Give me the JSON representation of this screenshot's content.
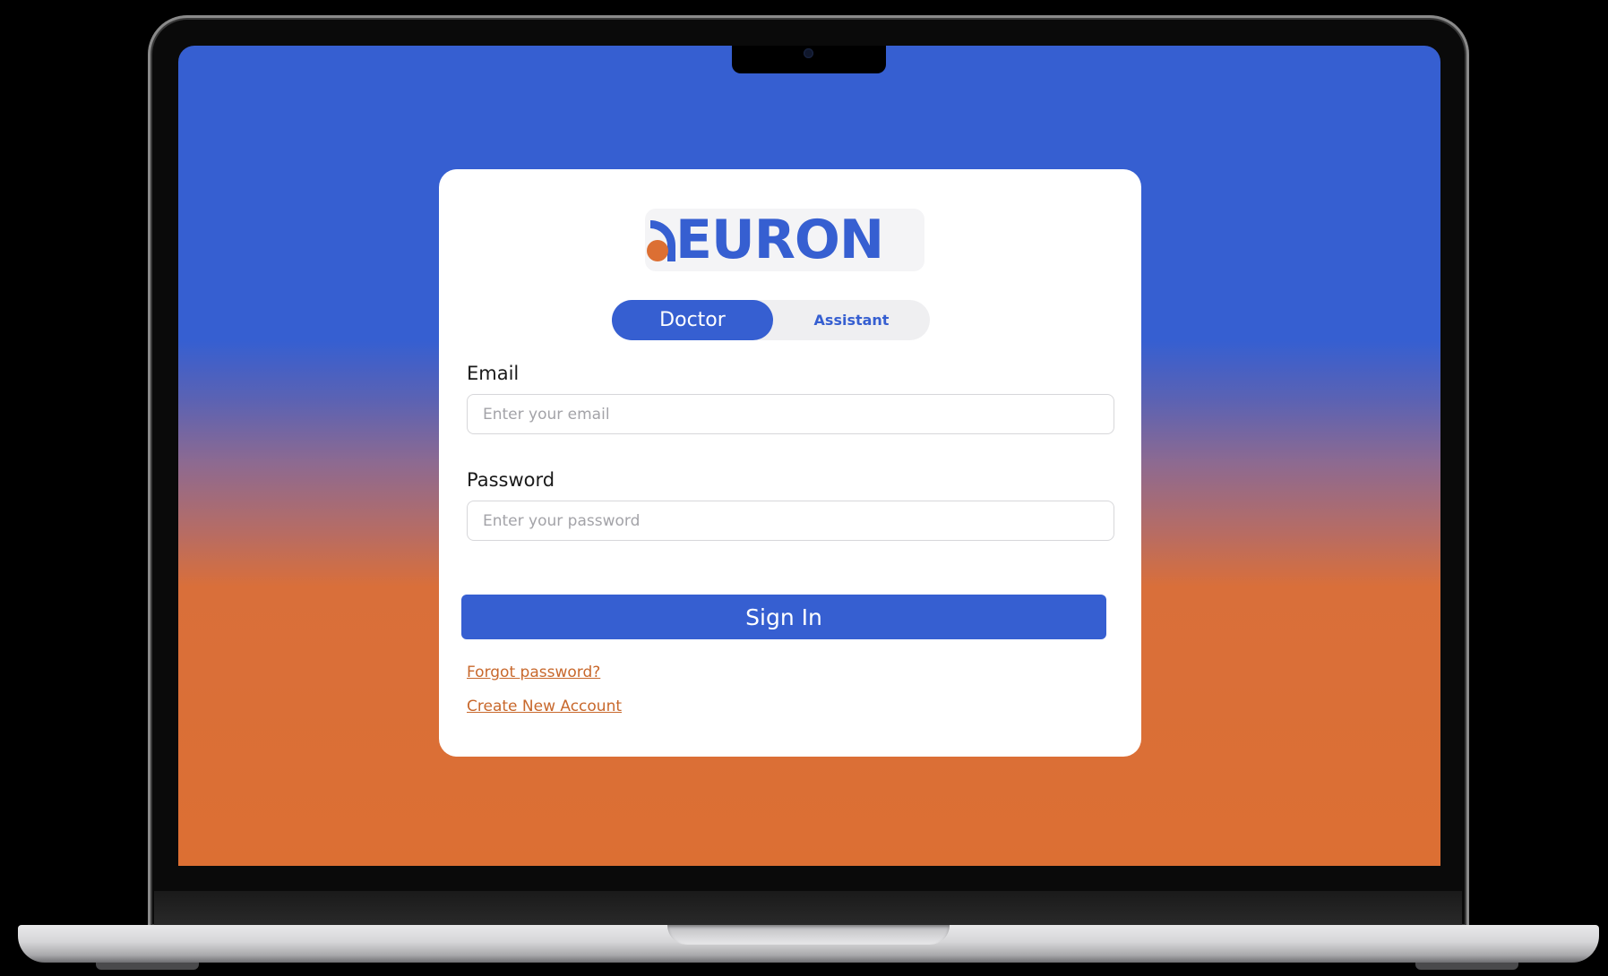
{
  "logo": {
    "wordmark": "EURON",
    "icon": "neuron-n-logo-icon"
  },
  "role_toggle": {
    "options": [
      {
        "label": "Doctor",
        "selected": true
      },
      {
        "label": "Assistant",
        "selected": false
      }
    ]
  },
  "form": {
    "email": {
      "label": "Email",
      "placeholder": "Enter your email",
      "value": ""
    },
    "password": {
      "label": "Password",
      "placeholder": "Enter your password",
      "value": ""
    },
    "submit_label": "Sign In"
  },
  "links": {
    "forgot_password": "Forgot password?",
    "create_account": "Create New Account"
  },
  "colors": {
    "primary": "#365fd1",
    "accent": "#dc6f33",
    "link": "#c8682c",
    "card": "#ffffff"
  }
}
